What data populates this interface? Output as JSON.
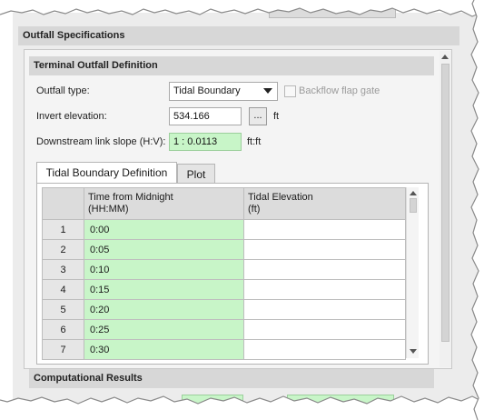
{
  "outfall_specifications": {
    "title": "Outfall Specifications"
  },
  "terminal_outfall": {
    "title": "Terminal Outfall Definition",
    "outfall_type_label": "Outfall type:",
    "outfall_type_value": "Tidal Boundary",
    "backflow_label": "Backflow flap gate",
    "invert_label": "Invert elevation:",
    "invert_value": "534.166",
    "invert_button": "...",
    "invert_unit": "ft",
    "slope_label": "Downstream link slope (H:V):",
    "slope_value": "1 : 0.0113",
    "slope_unit": "ft:ft"
  },
  "tabs": [
    {
      "label": "Tidal Boundary Definition",
      "active": true
    },
    {
      "label": "Plot",
      "active": false
    }
  ],
  "grid": {
    "col1_header_line1": "Time from Midnight",
    "col1_header_line2": "(HH:MM)",
    "col2_header_line1": "Tidal Elevation",
    "col2_header_line2": "(ft)",
    "rows": [
      {
        "index": "1",
        "time": "0:00",
        "elevation": ""
      },
      {
        "index": "2",
        "time": "0:05",
        "elevation": ""
      },
      {
        "index": "3",
        "time": "0:10",
        "elevation": ""
      },
      {
        "index": "4",
        "time": "0:15",
        "elevation": ""
      },
      {
        "index": "5",
        "time": "0:20",
        "elevation": ""
      },
      {
        "index": "6",
        "time": "0:25",
        "elevation": ""
      },
      {
        "index": "7",
        "time": "0:30",
        "elevation": ""
      }
    ]
  },
  "computational_results": {
    "title": "Computational Results"
  },
  "colors": {
    "editable_green": "#c8f5c8",
    "header_gray": "#d7d7d7",
    "panel_bg": "#f4f4f4"
  },
  "icons": {
    "dropdown": "chevron-down-icon",
    "scroll_up": "scroll-up-icon",
    "scroll_down": "scroll-down-icon"
  }
}
